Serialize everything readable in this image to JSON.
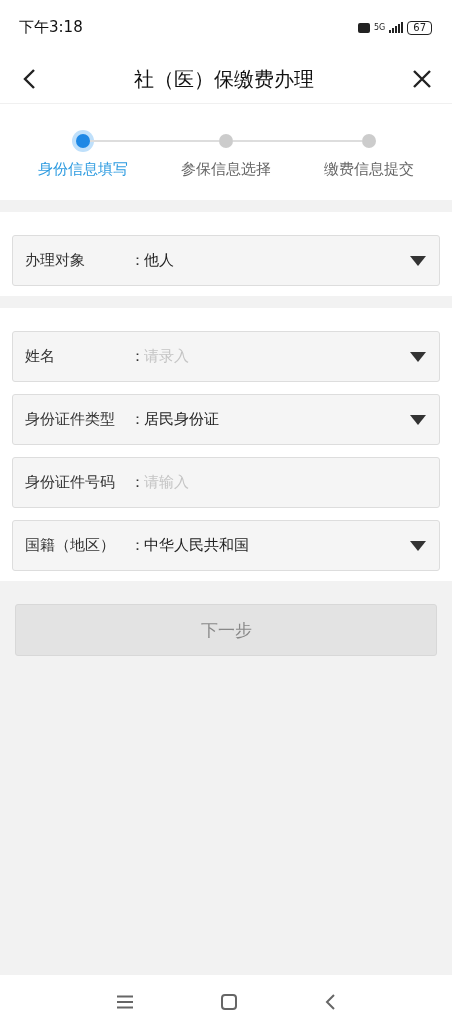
{
  "status_bar": {
    "time": "下午3:18",
    "network": "5G",
    "battery": "67"
  },
  "header": {
    "title": "社（医）保缴费办理"
  },
  "steps": [
    {
      "label": "身份信息填写",
      "selected": true
    },
    {
      "label": "参保信息选择",
      "selected": false
    },
    {
      "label": "缴费信息提交",
      "selected": false
    }
  ],
  "sections": [
    {
      "fields": [
        {
          "kind": "select",
          "label": "办理对象",
          "separator": "：",
          "value": "他人"
        }
      ]
    },
    {
      "fields": [
        {
          "kind": "select",
          "label": "姓名",
          "separator": "：",
          "placeholder": "请录入"
        },
        {
          "kind": "select",
          "label": "身份证件类型",
          "separator": "：",
          "value": "居民身份证"
        },
        {
          "kind": "input",
          "label": "身份证件号码",
          "separator": "：",
          "placeholder": "请输入"
        },
        {
          "kind": "select",
          "label": "国籍（地区）",
          "separator": "：",
          "value": "中华人民共和国"
        }
      ]
    }
  ],
  "next_button": {
    "label": "下一步",
    "disabled": true
  }
}
